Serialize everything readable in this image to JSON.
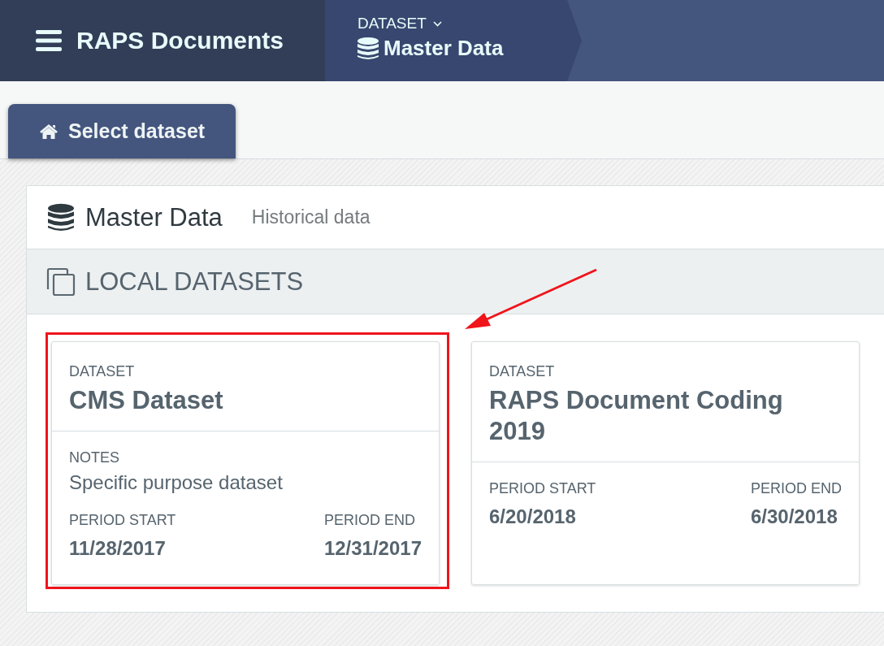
{
  "app": {
    "title": "RAPS Documents"
  },
  "breadcrumb": {
    "label": "DATASET",
    "value": "Master Data"
  },
  "tabs": [
    {
      "label": "Select dataset",
      "selected": true
    }
  ],
  "panel": {
    "title": "Master Data",
    "subtitle": "Historical data",
    "section_title": "LOCAL DATASETS"
  },
  "datasets": [
    {
      "label": "DATASET",
      "name": "CMS Dataset",
      "notes_label": "NOTES",
      "notes": "Specific purpose dataset",
      "start_label": "PERIOD START",
      "start": "11/28/2017",
      "end_label": "PERIOD END",
      "end": "12/31/2017",
      "highlighted": true
    },
    {
      "label": "DATASET",
      "name": "RAPS Document Coding 2019",
      "start_label": "PERIOD START",
      "start": "6/20/2018",
      "end_label": "PERIOD END",
      "end": "6/30/2018",
      "highlighted": false
    }
  ]
}
